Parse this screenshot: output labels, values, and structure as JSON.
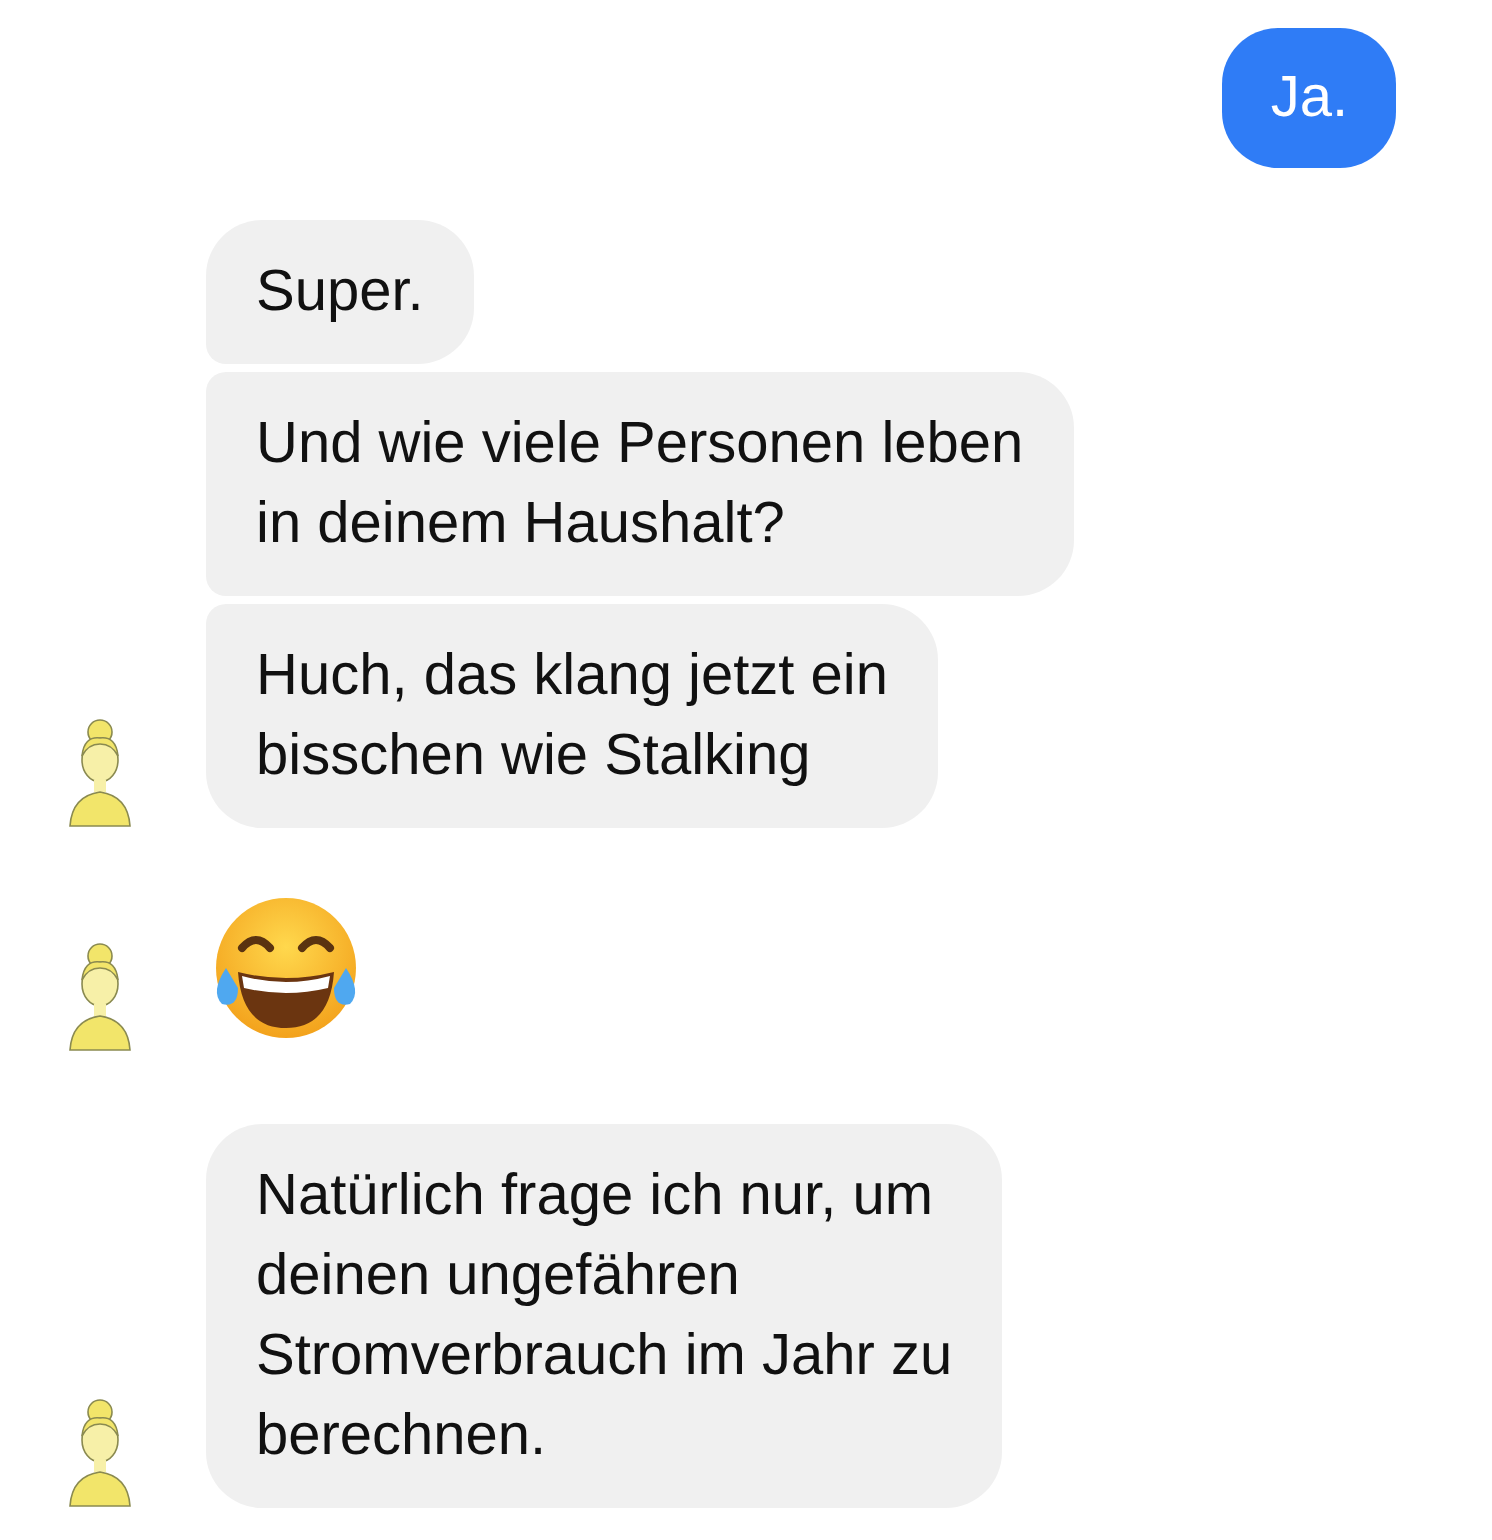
{
  "messages": [
    {
      "outgoing": true,
      "kind": "text",
      "text": "Ja."
    },
    {
      "outgoing": false,
      "kind": "text",
      "text": "Super.",
      "avatar": false
    },
    {
      "outgoing": false,
      "kind": "text",
      "text": "Und wie viele Personen leben\nin deinem Haushalt?",
      "avatar": false
    },
    {
      "outgoing": false,
      "kind": "text",
      "text": "Huch, das klang jetzt ein\nbisschen wie Stalking",
      "avatar": true
    },
    {
      "outgoing": false,
      "kind": "emoji",
      "avatar": true
    },
    {
      "outgoing": false,
      "kind": "text",
      "text": "Natürlich frage ich nur, um\ndeinen ungefähren\nStromverbrauch im Jahr zu\nberechnen.",
      "avatar": true
    }
  ]
}
